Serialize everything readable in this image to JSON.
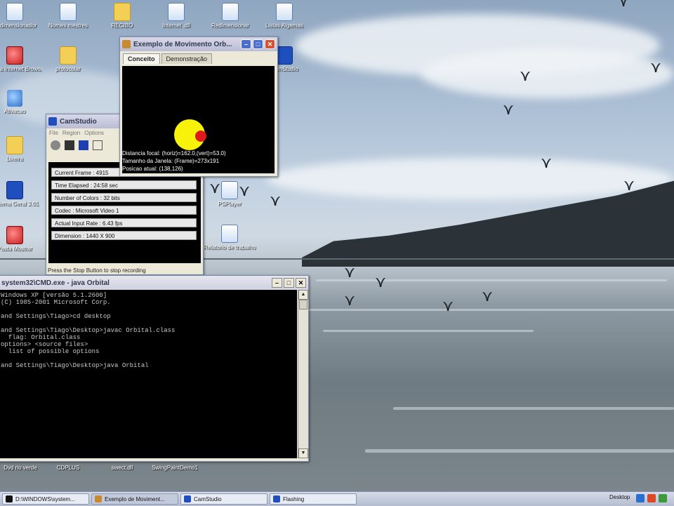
{
  "desktop": {
    "icons": [
      {
        "label": "Redimensionador",
        "glyph": "document-icon"
      },
      {
        "label": "Nomes mestres",
        "glyph": "document-icon"
      },
      {
        "label": "RECIBO",
        "glyph": "folder-icon"
      },
      {
        "label": "Internet .dll",
        "glyph": "document-icon"
      },
      {
        "label": "Redimensionar",
        "glyph": "document-icon"
      },
      {
        "label": "Listas Algemas",
        "glyph": "document-icon"
      },
      {
        "label": "Opera Internet Browser",
        "glyph": "browser-icon"
      },
      {
        "label": "protocolar",
        "glyph": "folder-icon"
      },
      {
        "label": "Ativacao",
        "glyph": "network-icon"
      },
      {
        "label": "Lixeira",
        "glyph": "folder-icon"
      },
      {
        "label": "Sistema Geral 3.01",
        "glyph": "app-icon"
      },
      {
        "label": "Pasta Mostrar",
        "glyph": "app-icon"
      },
      {
        "label": "PSPlayer",
        "glyph": "document-icon"
      },
      {
        "label": "Relatorio de trabalho",
        "glyph": "document-icon"
      },
      {
        "label": "CamStudio",
        "glyph": "app-icon"
      },
      {
        "label": "CDPLUS",
        "glyph": "document-icon"
      },
      {
        "label": "Dvd rio verde",
        "glyph": "document-icon"
      },
      {
        "label": "swect.dll",
        "glyph": "document-icon"
      },
      {
        "label": "SwingPaintDemo1",
        "glyph": "document-icon"
      }
    ]
  },
  "orbital_window": {
    "title": "Exemplo de Movimento Orb...",
    "tabs": [
      "Conceito",
      "Demonstração"
    ],
    "info_lines": [
      "Distancia focal: (horiz)=162.0,(vert)=53.0)",
      "Tamanho da Janela: (Frame)=273x191",
      "Posicao atual: (138,126)"
    ]
  },
  "camstudio_window": {
    "title": "CamStudio",
    "menu": [
      "File",
      "Region",
      "Options"
    ],
    "stats": [
      "Current Frame : 4915",
      "Time Elapsed : 24:58 sec",
      "Number of Colors : 32 bits",
      "Codec : Microsoft Video 1",
      "Actual Input Rate : 6.43 fps",
      "Dimension : 1440 X 900"
    ],
    "status": "Press the Stop Button to stop recording"
  },
  "console_window": {
    "title": "system32\\CMD.exe - java Orbital",
    "lines": [
      "Windows XP [versão 5.1.2600]",
      "(C) 1985-2001 Microsoft Corp.",
      "",
      "and Settings\\Tiago>cd desktop",
      "",
      "and Settings\\Tiago\\Desktop>javac Orbital.class",
      "  flag: Orbital.class",
      "options> <source files>",
      "  list of possible options",
      "",
      "and Settings\\Tiago\\Desktop>java Orbital"
    ]
  },
  "taskbar": {
    "tasks": [
      "D:\\WINDOWS\\system...",
      "Exemplo de Moviment...",
      "CamStudio",
      "Flashing"
    ],
    "active_task_index": 1,
    "desktop_label": "Desktop"
  },
  "colors": {
    "title_active": "#2459c8",
    "planet": "#f8f20b",
    "moon": "#e01a1a"
  }
}
